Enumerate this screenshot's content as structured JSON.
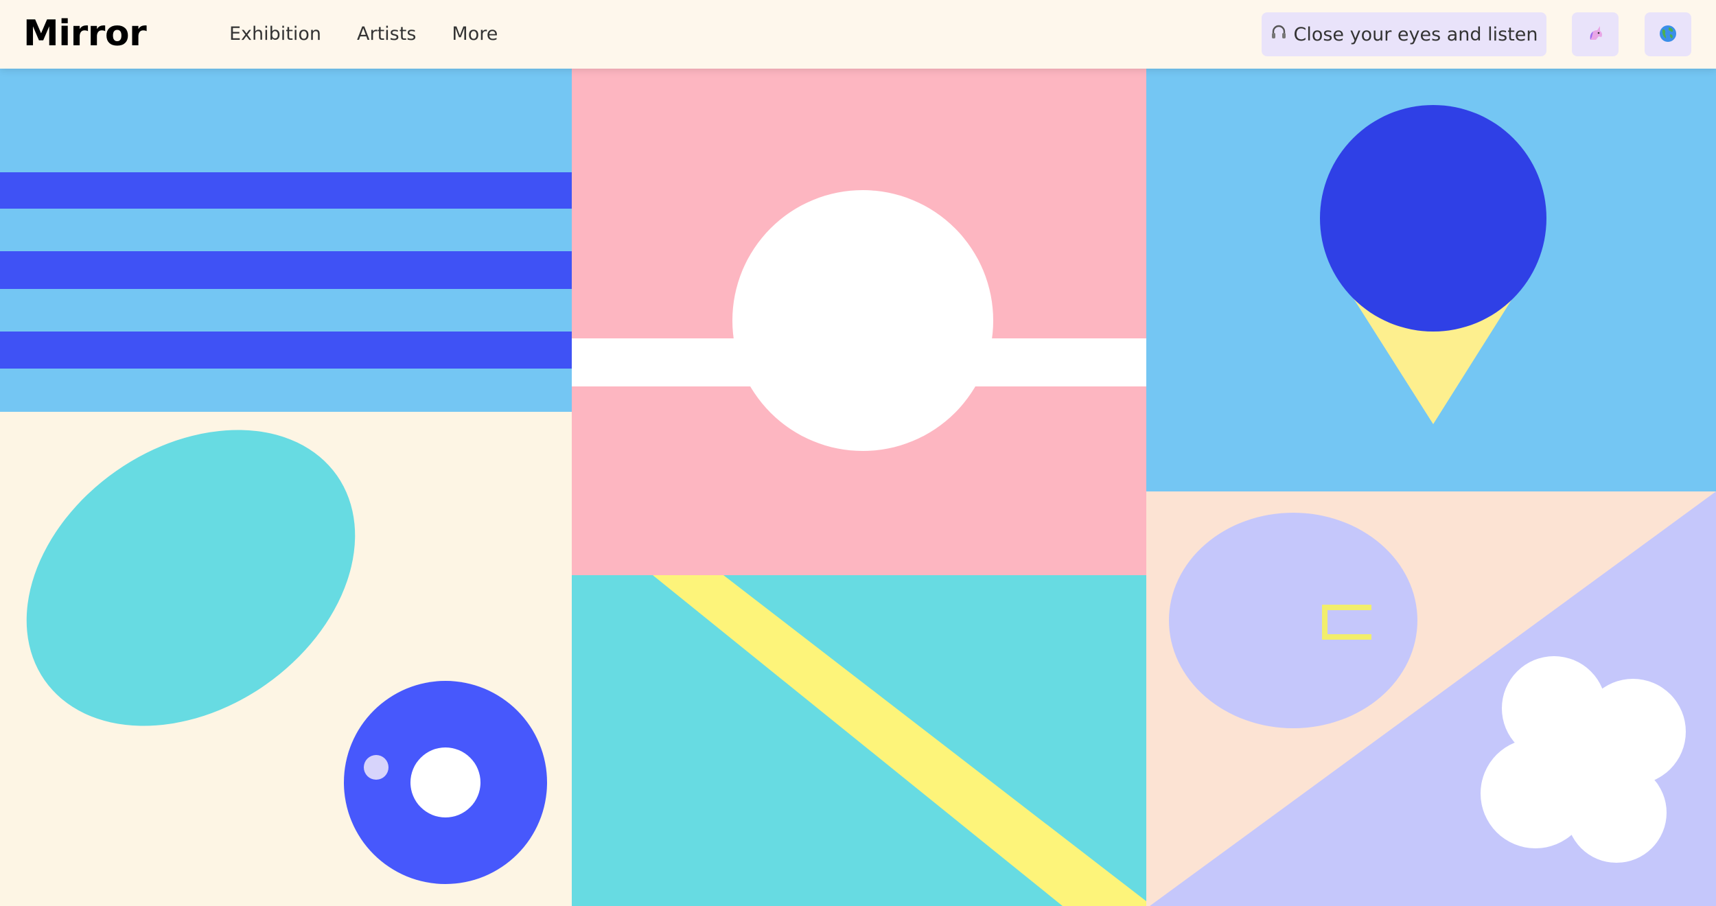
{
  "header": {
    "logo": "Mirror",
    "nav": [
      "Exhibition",
      "Artists",
      "More"
    ],
    "listen_label": "Close your eyes and listen",
    "listen_icon": "headphones-icon",
    "theme_icon": "unicorn-icon",
    "language_icon": "globe-icon"
  },
  "colors": {
    "header_bg": "#fef7ec",
    "button_bg": "#e9e3fa",
    "sky": "#74c6f3",
    "royal_blue": "#3f52f5",
    "pink": "#fdb6c1",
    "cream": "#fdf5e4",
    "turquoise": "#67dbe2",
    "yellow": "#fef47c",
    "peach": "#fce3d3",
    "lavender": "#c5c7fb",
    "white": "#ffffff"
  }
}
